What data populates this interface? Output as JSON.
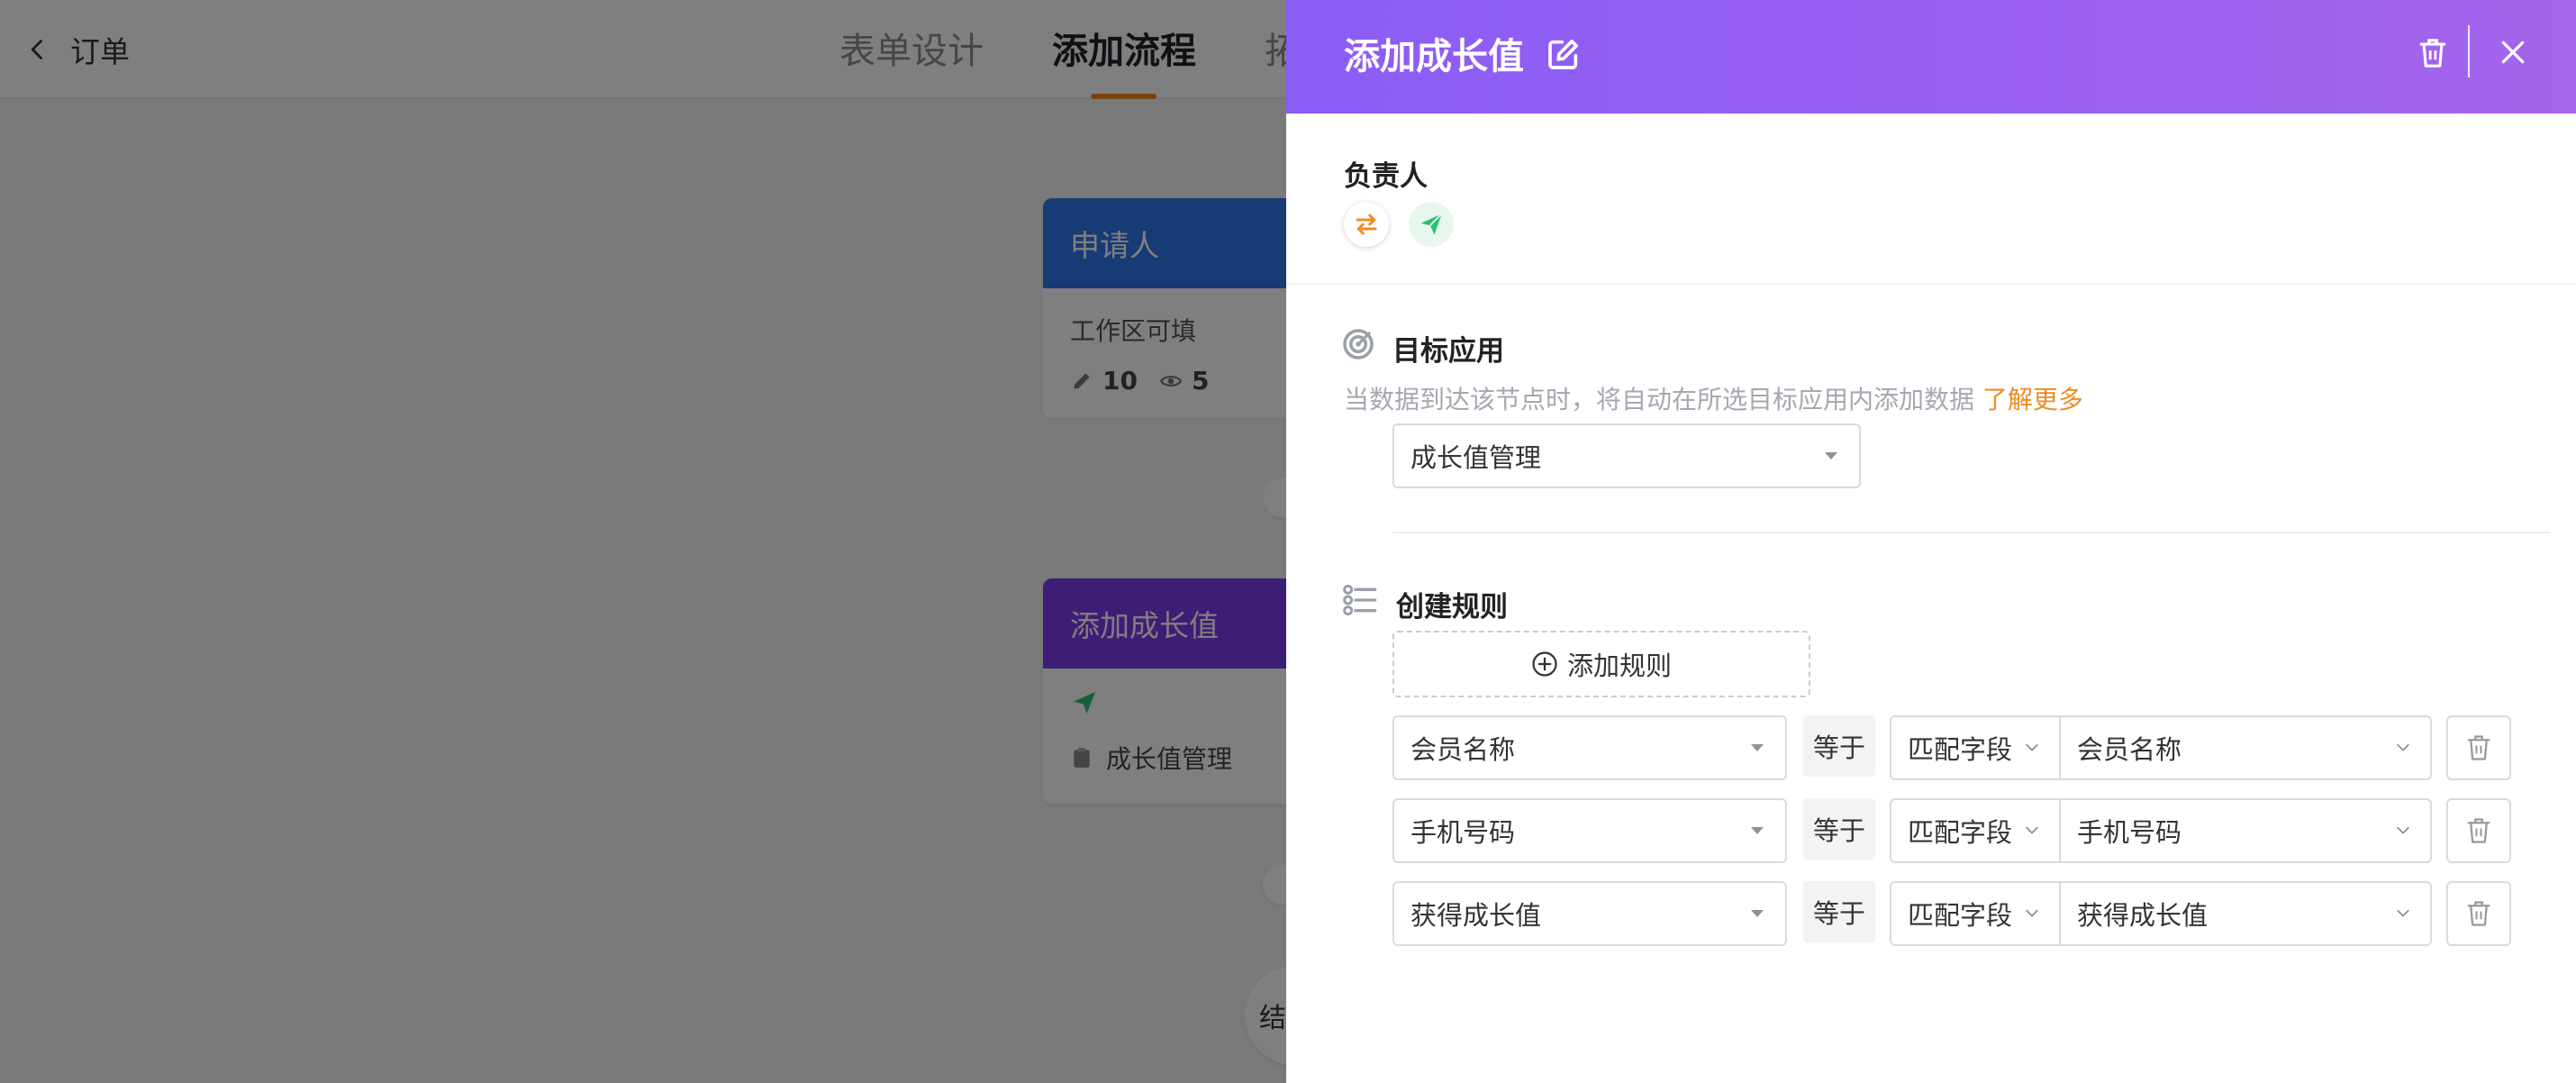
{
  "background": {
    "back_label": "订单",
    "tabs": [
      "表单设计",
      "添加流程",
      "拓"
    ],
    "nodes": {
      "applicant": {
        "title": "申请人",
        "line1": "工作区可填",
        "edit_count": "10",
        "view_count": "5"
      },
      "add_growth": {
        "title": "添加成长值",
        "app_name": "成长值管理"
      }
    },
    "end_label": "结"
  },
  "drawer": {
    "title": "添加成长值",
    "owner_label": "负责人",
    "target_app": {
      "label": "目标应用",
      "hint": "当数据到达该节点时，将自动在所选目标应用内添加数据",
      "learn_more": "了解更多",
      "selected": "成长值管理"
    },
    "rules": {
      "label": "创建规则",
      "add_button": "添加规则",
      "items": [
        {
          "field": "会员名称",
          "operator": "等于",
          "match_type": "匹配字段",
          "target": "会员名称"
        },
        {
          "field": "手机号码",
          "operator": "等于",
          "match_type": "匹配字段",
          "target": "手机号码"
        },
        {
          "field": "获得成长值",
          "operator": "等于",
          "match_type": "匹配字段",
          "target": "获得成长值"
        }
      ]
    }
  },
  "colors": {
    "header_gradient_start": "#8b5cf6",
    "header_gradient_end": "#a565ec",
    "accent_orange": "#ef8c22",
    "applicant_blue": "#2f77e8",
    "growth_purple": "#7c3aed",
    "send_green": "#2fbf71"
  }
}
